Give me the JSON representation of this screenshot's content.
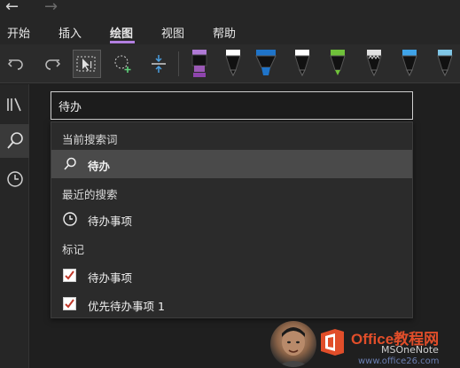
{
  "titlebar": {
    "back_arrow": "←",
    "forward_arrow": "→"
  },
  "menu": {
    "items": [
      "开始",
      "插入",
      "绘图",
      "视图",
      "帮助"
    ],
    "active": "绘图"
  },
  "toolbar": {
    "buttons": [
      "undo-icon",
      "redo-icon",
      "lasso-select-icon",
      "lasso-add-icon",
      "add-space-icon"
    ],
    "pens": [
      {
        "color": "#8e44ad",
        "tip": "highlighter"
      },
      {
        "color": "#ffffff",
        "tip": "pen"
      },
      {
        "color": "#1f74c9",
        "tip": "highlighter"
      },
      {
        "color": "#ffffff",
        "tip": "pen"
      },
      {
        "color": "#6fc13a",
        "tip": "pen"
      },
      {
        "color": "#ffffff",
        "tip": "galaxy"
      },
      {
        "color": "#3fa3e8",
        "tip": "pen"
      },
      {
        "color": "#7fc6e6",
        "tip": "pen"
      }
    ]
  },
  "sidebar": {
    "items": [
      "notebooks-icon",
      "search-icon",
      "recent-icon"
    ],
    "active": "search-icon"
  },
  "search": {
    "query": "待办"
  },
  "dropdown": {
    "current_header": "当前搜索词",
    "current_term": "待办",
    "recent_header": "最近的搜索",
    "recent_items": [
      "待办事项"
    ],
    "tags_header": "标记",
    "tag_items": [
      "待办事项",
      "优先待办事项 1"
    ]
  },
  "watermark": {
    "brand": "Office教程网",
    "url": "www.office26.com",
    "channel": "MSOneNote"
  }
}
